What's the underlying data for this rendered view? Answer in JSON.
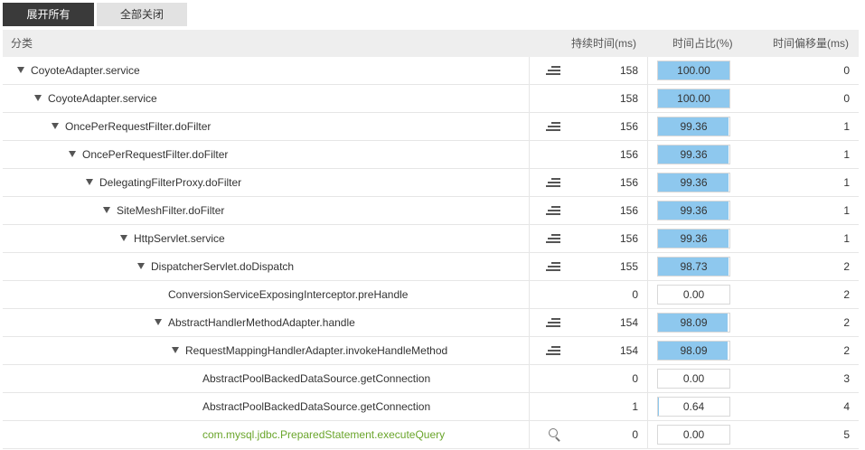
{
  "toolbar": {
    "expand_all_label": "展开所有",
    "close_all_label": "全部关闭"
  },
  "table": {
    "headers": {
      "category": "分类",
      "duration": "持续时间(ms)",
      "percent": "时间占比(%)",
      "offset": "时间偏移量(ms)"
    },
    "rows": [
      {
        "name": "CoyoteAdapter.service",
        "depth": 0,
        "expandable": true,
        "icon": "menu-icon",
        "duration": "158",
        "percent_text": "100.00",
        "percent": 100,
        "offset": "0",
        "highlight": false
      },
      {
        "name": "CoyoteAdapter.service",
        "depth": 1,
        "expandable": true,
        "icon": "none",
        "duration": "158",
        "percent_text": "100.00",
        "percent": 100,
        "offset": "0",
        "highlight": false
      },
      {
        "name": "OncePerRequestFilter.doFilter",
        "depth": 2,
        "expandable": true,
        "icon": "menu-icon",
        "duration": "156",
        "percent_text": "99.36",
        "percent": 99.36,
        "offset": "1",
        "highlight": false
      },
      {
        "name": "OncePerRequestFilter.doFilter",
        "depth": 3,
        "expandable": true,
        "icon": "none",
        "duration": "156",
        "percent_text": "99.36",
        "percent": 99.36,
        "offset": "1",
        "highlight": false
      },
      {
        "name": "DelegatingFilterProxy.doFilter",
        "depth": 4,
        "expandable": true,
        "icon": "menu-icon",
        "duration": "156",
        "percent_text": "99.36",
        "percent": 99.36,
        "offset": "1",
        "highlight": false
      },
      {
        "name": "SiteMeshFilter.doFilter",
        "depth": 5,
        "expandable": true,
        "icon": "menu-icon",
        "duration": "156",
        "percent_text": "99.36",
        "percent": 99.36,
        "offset": "1",
        "highlight": false
      },
      {
        "name": "HttpServlet.service",
        "depth": 6,
        "expandable": true,
        "icon": "menu-icon",
        "duration": "156",
        "percent_text": "99.36",
        "percent": 99.36,
        "offset": "1",
        "highlight": false
      },
      {
        "name": "DispatcherServlet.doDispatch",
        "depth": 7,
        "expandable": true,
        "icon": "menu-icon",
        "duration": "155",
        "percent_text": "98.73",
        "percent": 98.73,
        "offset": "2",
        "highlight": false
      },
      {
        "name": "ConversionServiceExposingInterceptor.preHandle",
        "depth": 8,
        "expandable": false,
        "icon": "none",
        "duration": "0",
        "percent_text": "0.00",
        "percent": 0,
        "offset": "2",
        "highlight": false
      },
      {
        "name": "AbstractHandlerMethodAdapter.handle",
        "depth": 8,
        "expandable": true,
        "icon": "menu-icon",
        "duration": "154",
        "percent_text": "98.09",
        "percent": 98.09,
        "offset": "2",
        "highlight": false
      },
      {
        "name": "RequestMappingHandlerAdapter.invokeHandleMethod",
        "depth": 9,
        "expandable": true,
        "icon": "menu-icon",
        "duration": "154",
        "percent_text": "98.09",
        "percent": 98.09,
        "offset": "2",
        "highlight": false
      },
      {
        "name": "AbstractPoolBackedDataSource.getConnection",
        "depth": 10,
        "expandable": false,
        "icon": "none",
        "duration": "0",
        "percent_text": "0.00",
        "percent": 0,
        "offset": "3",
        "highlight": false
      },
      {
        "name": "AbstractPoolBackedDataSource.getConnection",
        "depth": 10,
        "expandable": false,
        "icon": "none",
        "duration": "1",
        "percent_text": "0.64",
        "percent": 0.64,
        "offset": "4",
        "highlight": false
      },
      {
        "name": "com.mysql.jdbc.PreparedStatement.executeQuery",
        "depth": 10,
        "expandable": false,
        "icon": "search-icon",
        "duration": "0",
        "percent_text": "0.00",
        "percent": 0,
        "offset": "5",
        "highlight": true
      }
    ]
  },
  "colors": {
    "bar_fill": "#8ec8ee",
    "highlight_text": "#6aa52b",
    "header_bg": "#eeeeee",
    "dark_button": "#3a3a3a"
  }
}
